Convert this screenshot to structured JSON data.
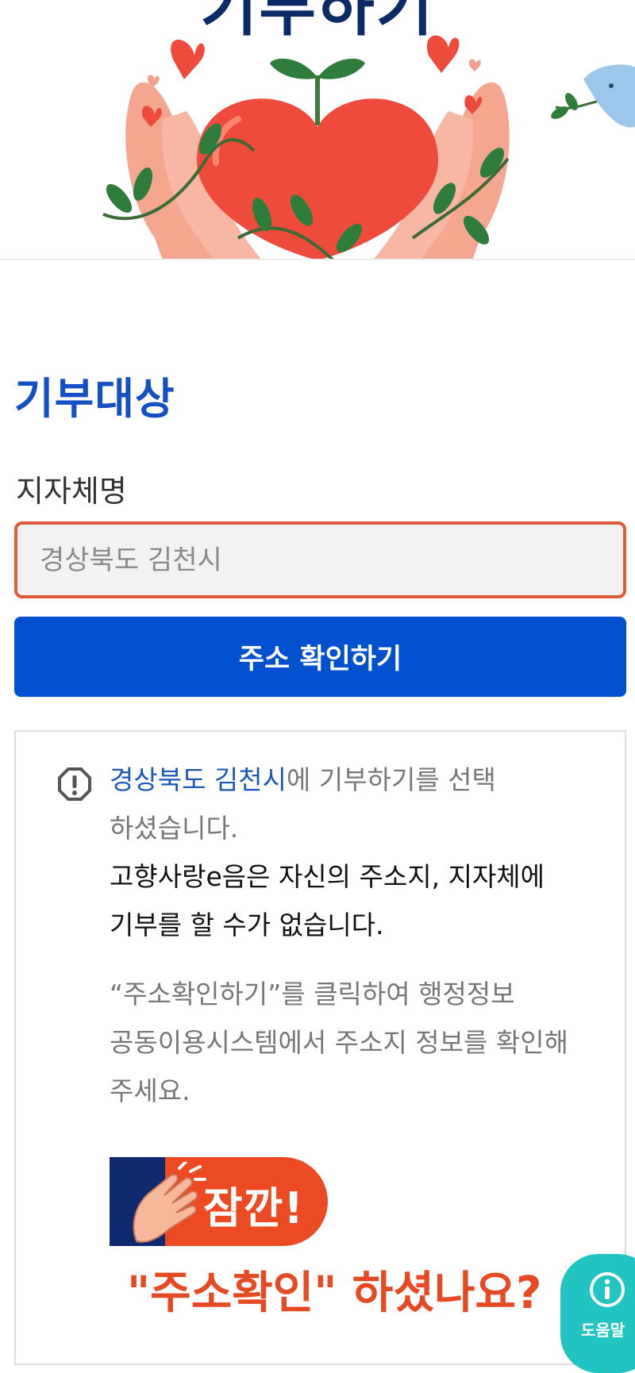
{
  "hero": {
    "title": "기부하기"
  },
  "section": {
    "title": "기부대상",
    "field_label": "지자체명"
  },
  "region_input": {
    "value": "경상북도 김천시",
    "placeholder": "경상북도 김천시"
  },
  "confirm_button": {
    "label": "주소 확인하기"
  },
  "notice": {
    "region": "경상북도 김천시",
    "selected_suffix": "에 기부하기를 선택",
    "selected_line2": "하셨습니다.",
    "restriction_line1": "고향사랑e음은 자신의 주소지, 지자체에",
    "restriction_line2": "기부를 할 수가 없습니다.",
    "instruction_line1": "“주소확인하기”를 클릭하여 행정정보",
    "instruction_line2": "공동이용시스템에서 주소지 정보를 확인해",
    "instruction_line3": "주세요.",
    "wait_badge": "잠깐!",
    "question": "\"주소확인\" 하셨나요?"
  },
  "help": {
    "label": "도움말"
  },
  "colors": {
    "brand_blue": "#0050cf",
    "title_blue": "#1250c4",
    "highlight_blue": "#1a57bd",
    "input_border": "#e05a3a",
    "warning_orange": "#e64a22",
    "help_teal": "#22c4c1",
    "navy": "#0d2a6e"
  },
  "icons": {
    "notice": "exclamation-octagon-icon",
    "help": "info-circle-icon",
    "wait": "clapping-hand-icon"
  }
}
